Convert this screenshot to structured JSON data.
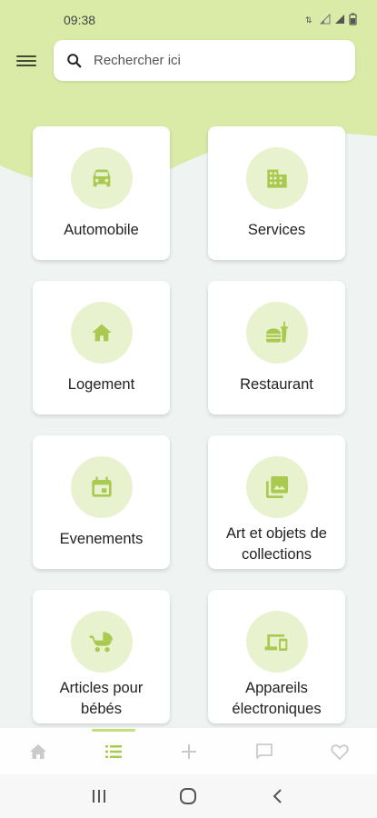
{
  "status_bar": {
    "time": "09:38"
  },
  "search": {
    "placeholder": "Rechercher ici"
  },
  "colors": {
    "accent": "#a9c94f",
    "icon_circle": "#e8f2cf",
    "header_bg": "#daeba8"
  },
  "categories": [
    {
      "label": "Automobile",
      "icon": "car-icon"
    },
    {
      "label": "Services",
      "icon": "building-icon"
    },
    {
      "label": "Logement",
      "icon": "house-icon"
    },
    {
      "label": "Restaurant",
      "icon": "fastfood-icon"
    },
    {
      "label": "Evenements",
      "icon": "calendar-icon"
    },
    {
      "label": "Art et objets de collections",
      "icon": "photo-library-icon"
    },
    {
      "label": "Articles pour bébés",
      "icon": "stroller-icon"
    },
    {
      "label": "Appareils électroniques",
      "icon": "devices-icon"
    }
  ],
  "bottom_nav": [
    {
      "icon": "home-icon",
      "active": false
    },
    {
      "icon": "list-icon",
      "active": true
    },
    {
      "icon": "plus-icon",
      "active": false
    },
    {
      "icon": "chat-icon",
      "active": false
    },
    {
      "icon": "heart-icon",
      "active": false
    }
  ],
  "system_nav": [
    {
      "icon": "recents-icon"
    },
    {
      "icon": "home-circle-icon"
    },
    {
      "icon": "back-icon"
    }
  ]
}
